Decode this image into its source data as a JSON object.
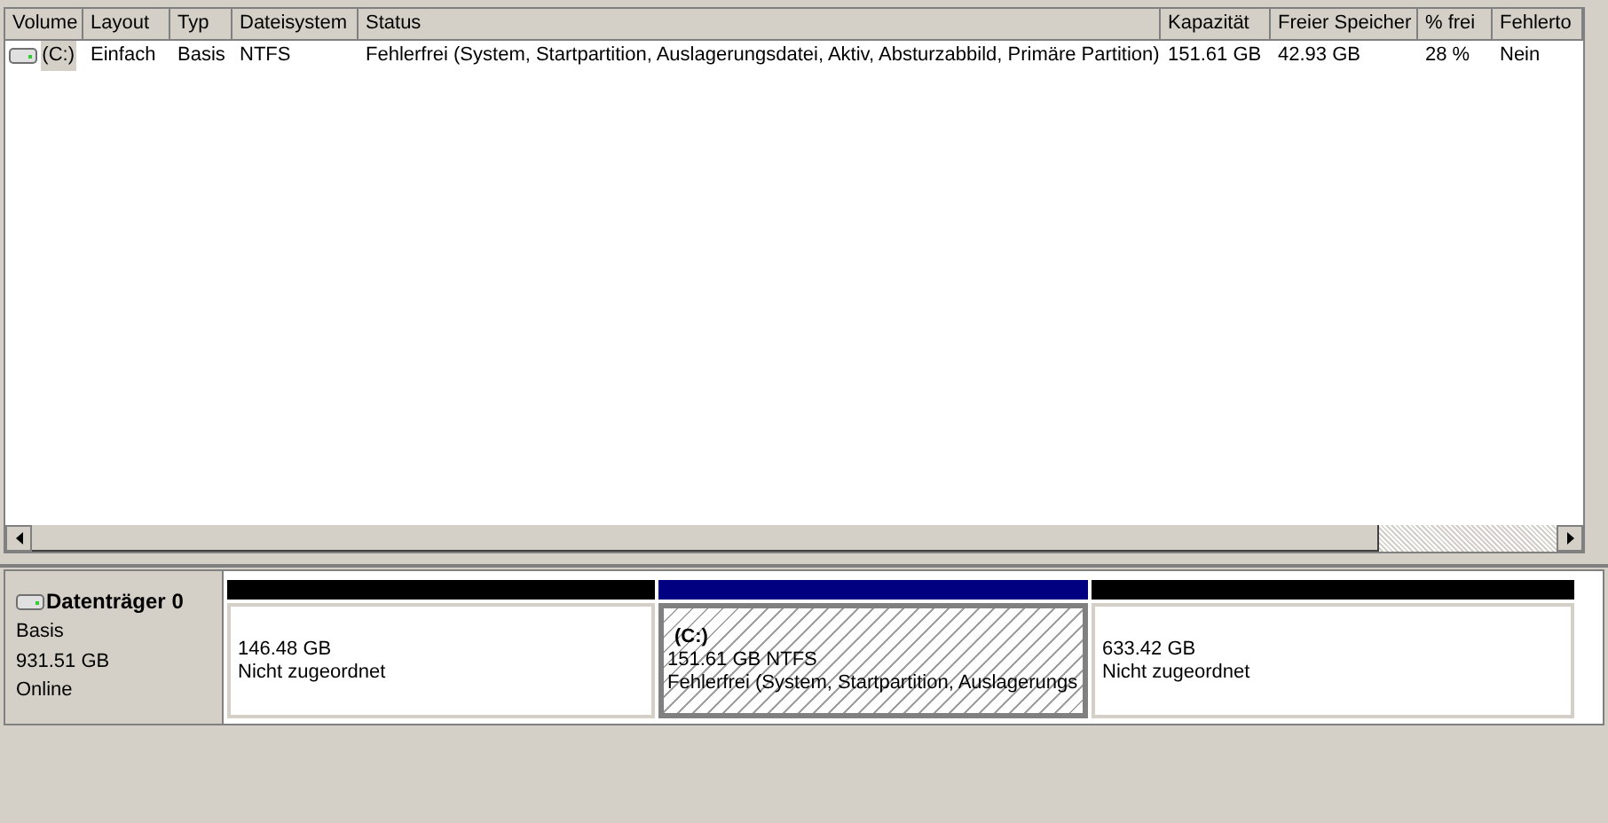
{
  "volume_list": {
    "columns": [
      "Volume",
      "Layout",
      "Typ",
      "Dateisystem",
      "Status",
      "Kapazität",
      "Freier Speicher",
      "% frei",
      "Fehlerto"
    ],
    "rows": [
      {
        "cells": [
          "(C:)",
          "Einfach",
          "Basis",
          "NTFS",
          "Fehlerfrei (System, Startpartition, Auslagerungsdatei, Aktiv, Absturzabbild, Primäre Partition)",
          "151.61 GB",
          "42.93 GB",
          "28 %",
          "Nein"
        ],
        "selected": false
      }
    ]
  },
  "disk": {
    "name": "Datenträger 0",
    "type": "Basis",
    "size": "931.51 GB",
    "state": "Online",
    "partitions": [
      {
        "size": "146.48 GB",
        "status": "Nicht zugeordnet",
        "color": "#000000",
        "selected": false
      },
      {
        "label": "(C:)",
        "size": "151.61 GB NTFS",
        "status": "Fehlerfrei (System, Startpartition, Auslagerungs",
        "color": "#000080",
        "selected": true
      },
      {
        "size": "633.42 GB",
        "status": "Nicht zugeordnet",
        "color": "#000000",
        "selected": false
      }
    ]
  }
}
